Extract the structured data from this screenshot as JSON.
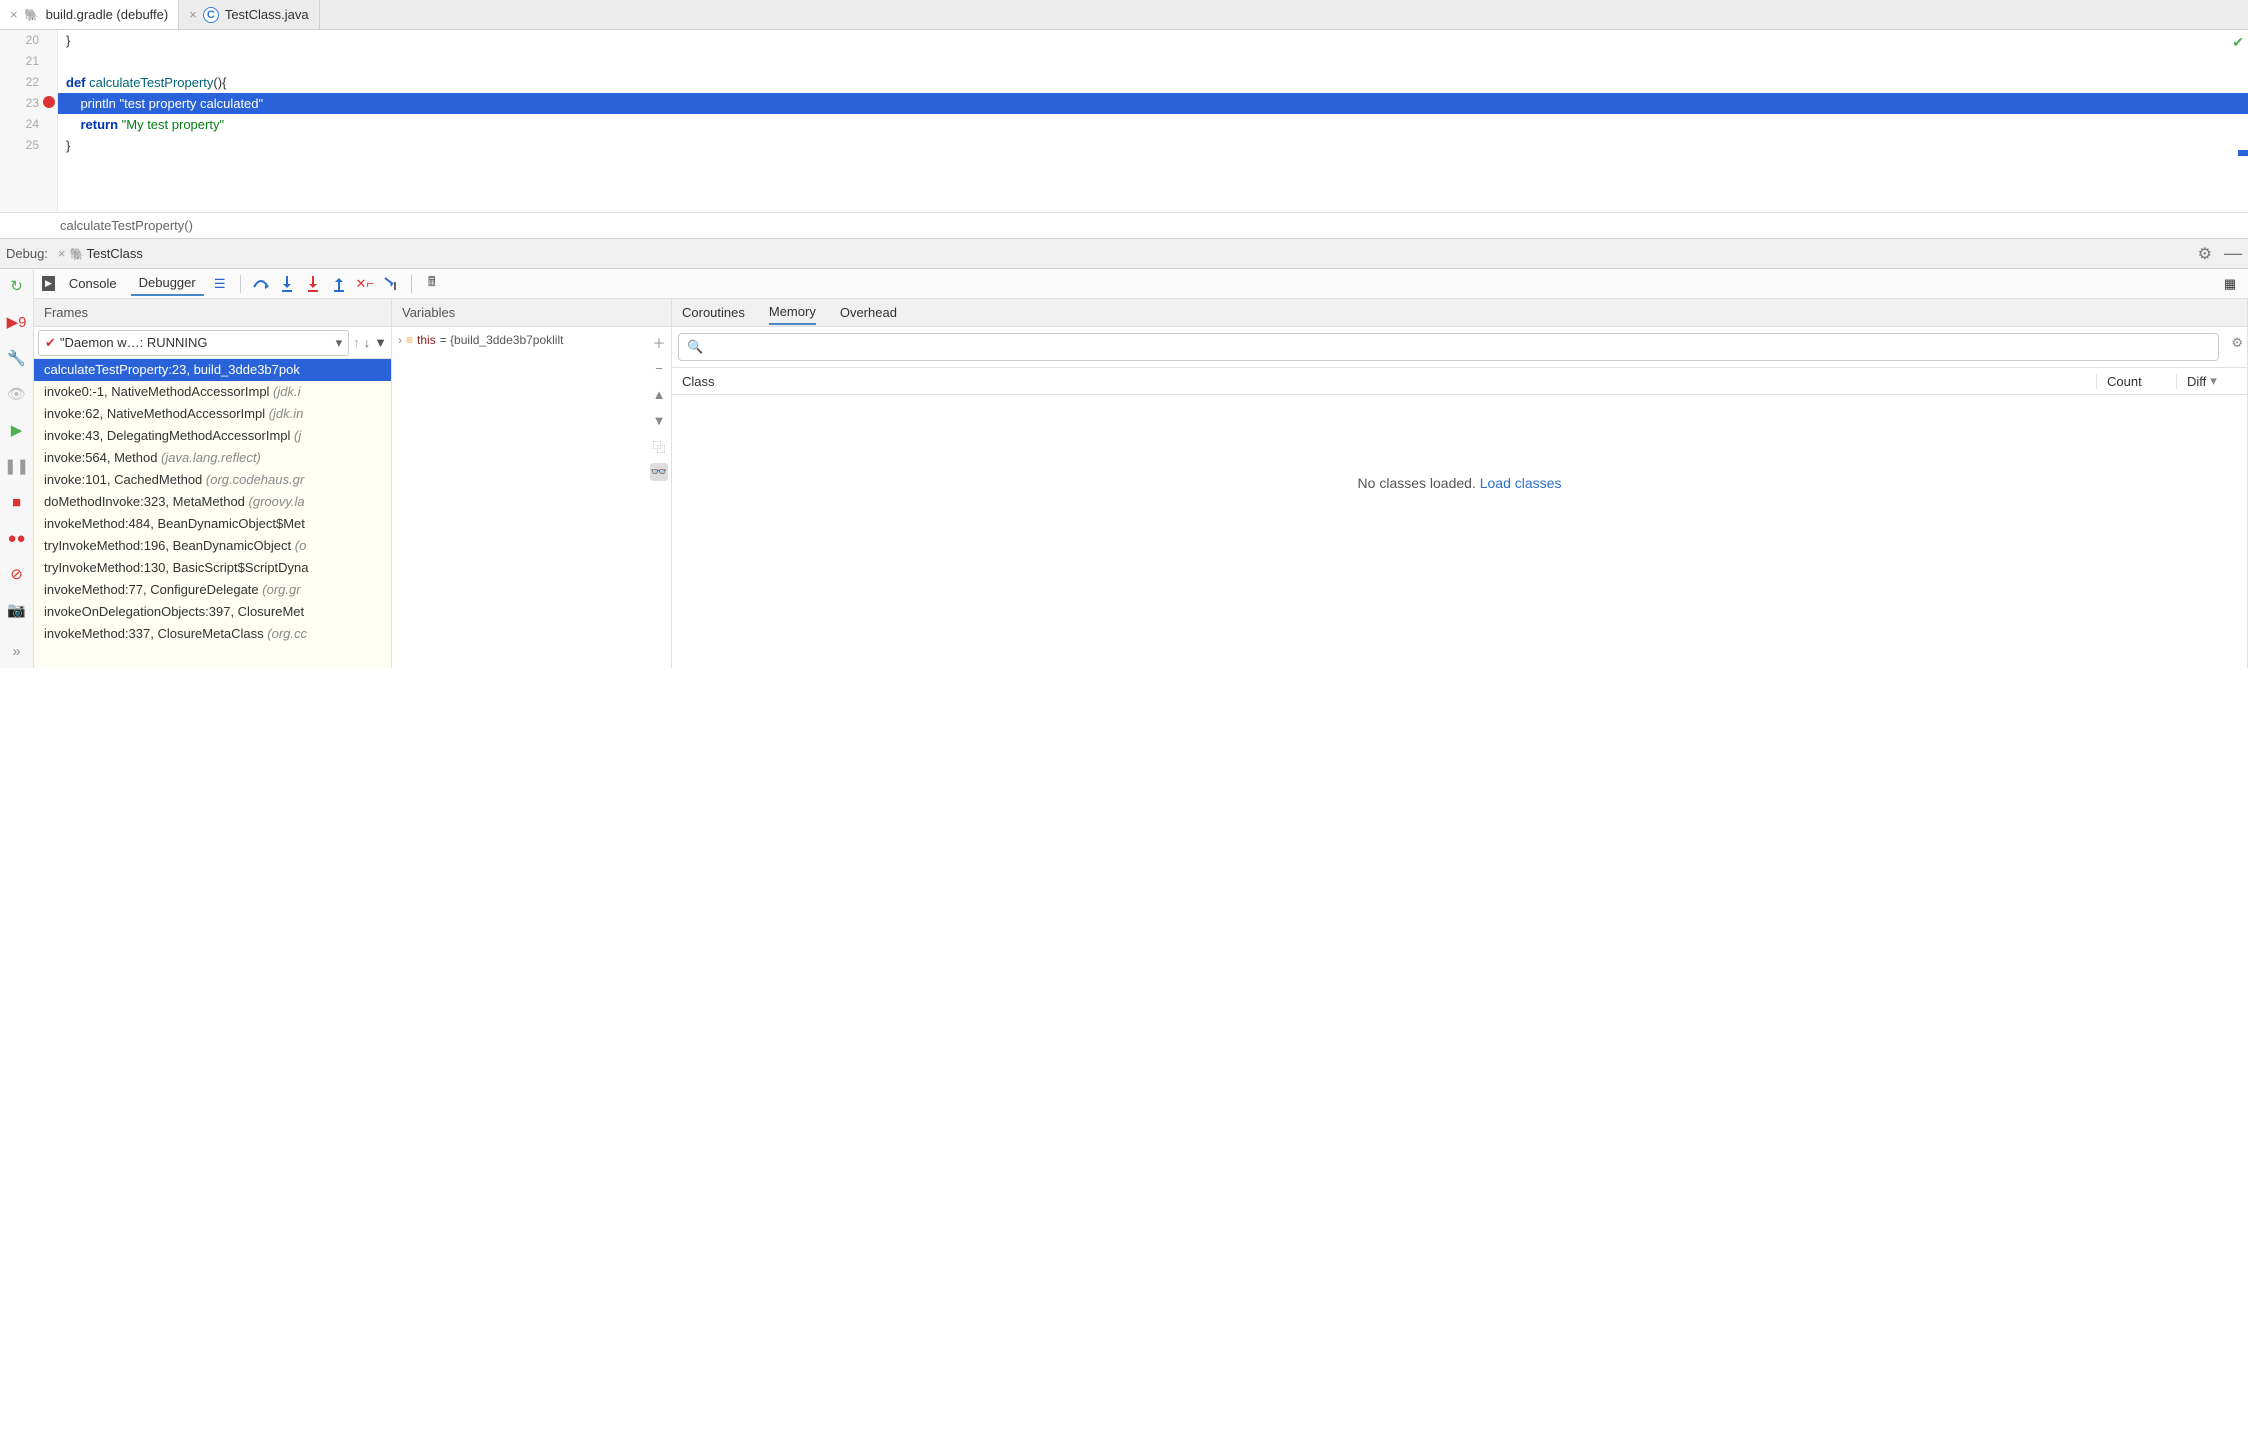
{
  "tabs": [
    {
      "label": "build.gradle (debuffe)",
      "icon": "gradle",
      "active": true
    },
    {
      "label": "TestClass.java",
      "icon": "java",
      "active": false
    }
  ],
  "editor": {
    "lines": [
      "20",
      "21",
      "22",
      "23",
      "24",
      "25"
    ],
    "breakpoint_line": "23",
    "code": {
      "l20": "}",
      "l22_kw": "def",
      "l22_fn": "calculateTestProperty",
      "l22_rest": "(){",
      "l23_fn": "println",
      "l23_str": "\"test property calculated\"",
      "l24_kw": "return",
      "l24_str": "\"My test property\"",
      "l25": "}"
    }
  },
  "breadcrumb": "calculateTestProperty()",
  "debug_bar": {
    "label": "Debug:",
    "config": "TestClass"
  },
  "debugger_tabs": {
    "console": "Console",
    "debugger": "Debugger"
  },
  "frames": {
    "title": "Frames",
    "thread": "\"Daemon w…: RUNNING",
    "items": [
      {
        "text": "calculateTestProperty:23, build_3dde3b7pok",
        "dim": "",
        "selected": true
      },
      {
        "text": "invoke0:-1, NativeMethodAccessorImpl ",
        "dim": "(jdk.i"
      },
      {
        "text": "invoke:62, NativeMethodAccessorImpl ",
        "dim": "(jdk.in"
      },
      {
        "text": "invoke:43, DelegatingMethodAccessorImpl ",
        "dim": "(j"
      },
      {
        "text": "invoke:564, Method ",
        "dim": "(java.lang.reflect)"
      },
      {
        "text": "invoke:101, CachedMethod ",
        "dim": "(org.codehaus.gr"
      },
      {
        "text": "doMethodInvoke:323, MetaMethod ",
        "dim": "(groovy.la"
      },
      {
        "text": "invokeMethod:484, BeanDynamicObject$Met",
        "dim": ""
      },
      {
        "text": "tryInvokeMethod:196, BeanDynamicObject ",
        "dim": "(o"
      },
      {
        "text": "tryInvokeMethod:130, BasicScript$ScriptDyna",
        "dim": ""
      },
      {
        "text": "invokeMethod:77, ConfigureDelegate ",
        "dim": "(org.gr"
      },
      {
        "text": "invokeOnDelegationObjects:397, ClosureMet",
        "dim": ""
      },
      {
        "text": "invokeMethod:337, ClosureMetaClass ",
        "dim": "(org.cc"
      }
    ]
  },
  "variables": {
    "title": "Variables",
    "this_label": "this",
    "this_value": " = {build_3dde3b7poklilt"
  },
  "memory": {
    "tabs": {
      "coroutines": "Coroutines",
      "memory": "Memory",
      "overhead": "Overhead"
    },
    "cols": {
      "class": "Class",
      "count": "Count",
      "diff": "Diff"
    },
    "empty_text": "No classes loaded. ",
    "load_link": "Load classes"
  }
}
